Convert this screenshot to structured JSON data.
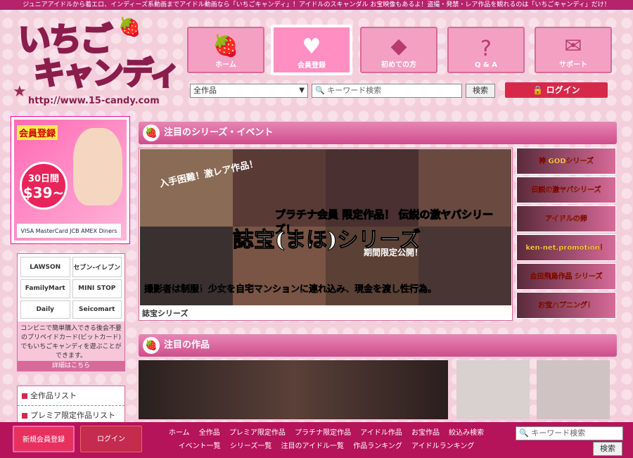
{
  "top_strip": "ジュニアアイドルから着エロ、インディーズ系動画までアイドル動画なら「いちごキャンディ」！アイドルのスキャンダル お宝映像もあるよ！盗撮・発禁・レア作品を観れるのは「いちごキャンディ」だけ！",
  "logo": {
    "line1": "いちご",
    "line2": "キャンディ",
    "url": "http://www.15-candy.com"
  },
  "nav": [
    {
      "label": "ホーム",
      "icon": "strawberry-icon"
    },
    {
      "label": "会員登録",
      "icon": "heart-plus-icon"
    },
    {
      "label": "初めての方",
      "icon": "beginner-icon"
    },
    {
      "label": "Q & A",
      "icon": "question-icon"
    },
    {
      "label": "サポート",
      "icon": "mail-icon"
    }
  ],
  "search": {
    "category": "全作品",
    "placeholder": "キーワード検索",
    "button": "検索",
    "login": "ログイン"
  },
  "banner": {
    "tag": "会員登録",
    "days": "30日間",
    "price": "$39~",
    "cards": "VISA  MasterCard  JCB  AMEX  Diners"
  },
  "cvs": {
    "logos": [
      "LAWSON",
      "セブン-イレブン",
      "FamilyMart",
      "MINI STOP",
      "Daily",
      "Seicomart"
    ],
    "desc": "コンビニで簡単購入できる後会不要のプリペイドカード(ビットカード)でもいちごキャンディを遊ぶことができます。",
    "more": "詳細はこちら"
  },
  "side_list": [
    "全作品リスト",
    "プレミア限定作品リスト"
  ],
  "sections": {
    "series": "注目のシリーズ・イベント",
    "works": "注目の作品"
  },
  "feature": {
    "t1": "プラチナ会員 限定作品！ 伝説の激ヤバシリーズ！",
    "t2": "誌宝(まほ)シリーズ",
    "t3": "期間限定公開！",
    "t4": "撮影者は制服！少女を自宅マンションに連れ込み、現金を渡し性行為。",
    "t5": "入手困難！激レア作品！",
    "name": "誌宝シリーズ"
  },
  "thumbs": [
    "神 GODシリーズ",
    "伝説の激ヤバシリーズ",
    "アイドルの卵",
    "ken-net.promotion！",
    "金田飛鳥作品 シリーズ",
    "お宝ハプニング！"
  ],
  "footer": {
    "new_member": "新規会員登録",
    "login": "ログイン",
    "links_row1": [
      "ホーム",
      "全作品",
      "プレミア限定作品",
      "プラチナ限定作品",
      "アイドル作品",
      "お宝作品",
      "絞込み検索"
    ],
    "links_row2": [
      "イベント一覧",
      "シリーズ一覧",
      "注目のアイドル一覧",
      "作品ランキング",
      "アイドルランキング"
    ],
    "search_placeholder": "キーワード検索",
    "search_button": "検索"
  }
}
